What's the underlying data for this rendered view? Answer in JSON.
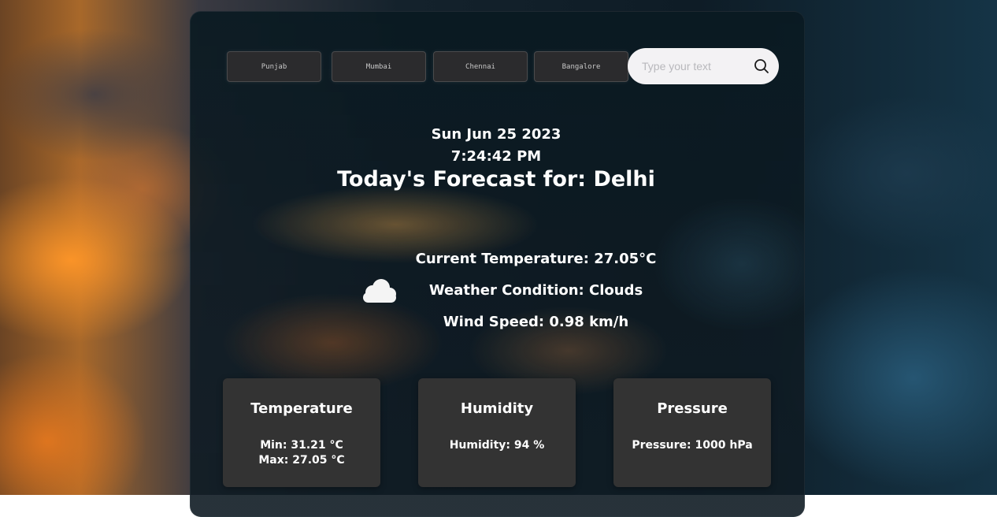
{
  "cities": [
    {
      "label": "Punjab"
    },
    {
      "label": "Mumbai"
    },
    {
      "label": "Chennai"
    },
    {
      "label": "Bangalore"
    }
  ],
  "search": {
    "placeholder": "Type your text",
    "value": ""
  },
  "datetime": {
    "date": "Sun Jun 25 2023",
    "time": "7:24:42 PM"
  },
  "forecast": {
    "heading": "Today's Forecast for: Delhi",
    "weather_icon": "cloud-icon",
    "current_temperature": "Current Temperature: 27.05°C",
    "weather_condition": "Weather Condition: Clouds",
    "wind_speed": "Wind Speed: 0.98 km/h"
  },
  "cards": {
    "temperature": {
      "title": "Temperature",
      "min": "Min: 31.21 °C",
      "max": "Max: 27.05 °C"
    },
    "humidity": {
      "title": "Humidity",
      "value": "Humidity: 94 %"
    },
    "pressure": {
      "title": "Pressure",
      "value": "Pressure: 1000 hPa"
    }
  },
  "colors": {
    "card_background": "#333333",
    "button_background": "#2b2b2d",
    "search_background": "#f3f2f4",
    "text": "#ffffff"
  }
}
